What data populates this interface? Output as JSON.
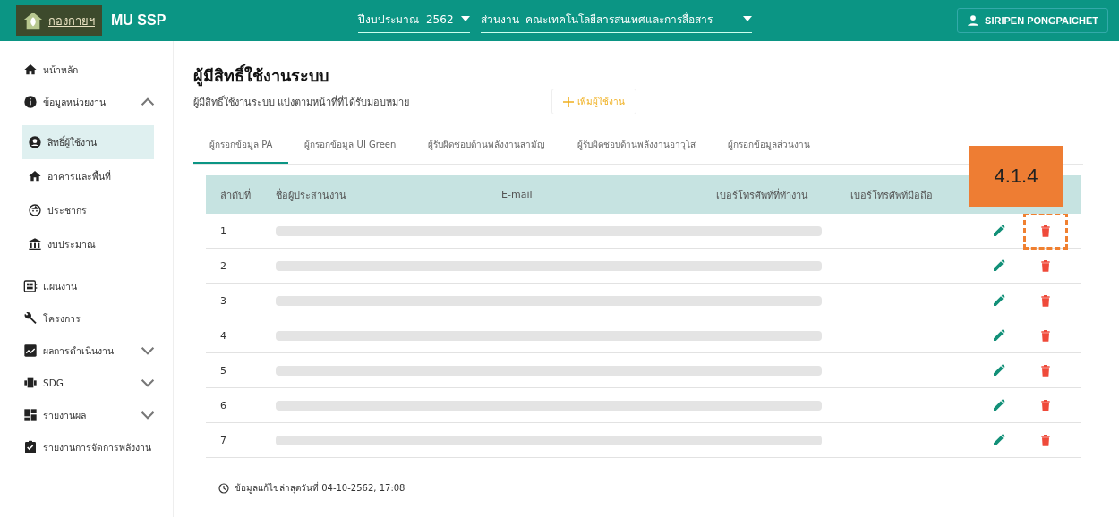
{
  "header": {
    "brand": "MU SSP",
    "logo_text": "กองกายฯ",
    "year_label": "ปีงบประมาณ",
    "year_value": "2562",
    "unit_label": "ส่วนงาน",
    "unit_value": "คณะเทคโนโลยีสารสนเทศและการสื่อสาร",
    "user": "SIRIPEN PONGPAICHET"
  },
  "sidebar": {
    "items": [
      {
        "label": "หน้าหลัก",
        "selected": false
      },
      {
        "label": "ข้อมูลหน่วยงาน",
        "selected": false,
        "expanded": true,
        "children": [
          {
            "label": "สิทธิ์ผู้ใช้งาน",
            "selected": true
          },
          {
            "label": "อาคารและพื้นที่",
            "selected": false
          },
          {
            "label": "ประชากร",
            "selected": false
          },
          {
            "label": "งบประมาณ",
            "selected": false
          }
        ]
      },
      {
        "label": "แผนงาน",
        "selected": false
      },
      {
        "label": "โครงการ",
        "selected": false
      },
      {
        "label": "ผลการดำเนินงาน",
        "selected": false,
        "expanded": false
      },
      {
        "label": "SDG",
        "selected": false,
        "expanded": false
      },
      {
        "label": "รายงานผล",
        "selected": false,
        "expanded": false
      },
      {
        "label": "รายงานการจัดการพลังงาน",
        "selected": false
      }
    ]
  },
  "page": {
    "title": "ผู้มีสิทธิ์ใช้งานระบบ",
    "subtitle": "ผู้มีสิทธิ์ใช้งานระบบ แบ่งตามหน้าที่ที่ได้รับมอบหมาย",
    "add_button": "เพิ่มผู้ใช้งาน"
  },
  "tabs": [
    {
      "label": "ผู้กรอกข้อมูล PA",
      "selected": true
    },
    {
      "label": "ผู้กรอกข้อมูล UI Green",
      "selected": false
    },
    {
      "label": "ผู้รับผิดชอบด้านพลังงานสามัญ",
      "selected": false
    },
    {
      "label": "ผู้รับผิดชอบด้านพลังงานอาวุโส",
      "selected": false
    },
    {
      "label": "ผู้กรอกข้อมูลส่วนงาน",
      "selected": false
    }
  ],
  "table": {
    "columns": [
      "ลำดับที่",
      "ชื่อผู้ประสานงาน",
      "E-mail",
      "เบอร์โทรศัพท์ที่ทำงาน",
      "เบอร์โทรศัพท์มือถือ"
    ],
    "rows": [
      {
        "number": "1",
        "highlighted": true
      },
      {
        "number": "2",
        "highlighted": false
      },
      {
        "number": "3",
        "highlighted": false
      },
      {
        "number": "4",
        "highlighted": false
      },
      {
        "number": "5",
        "highlighted": false
      },
      {
        "number": "6",
        "highlighted": false
      },
      {
        "number": "7",
        "highlighted": false
      }
    ]
  },
  "annotation": {
    "label": "4.1.4"
  },
  "footer": {
    "updated": "ข้อมูลแก้ไขล่าสุดวันที่ 04-10-2562, 17:08"
  }
}
